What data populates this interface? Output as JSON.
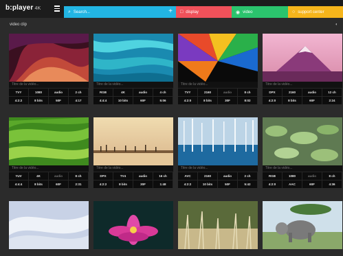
{
  "app": {
    "title": "b:player",
    "badge": "4K"
  },
  "topbar": {
    "search_placeholder": "Search...",
    "display_label": "display",
    "video_label": "video",
    "support_label": "support center"
  },
  "section": {
    "title": "video clip"
  },
  "colors": {
    "search": "#22b5e3",
    "display": "#f0515a",
    "video": "#2bc46d",
    "support": "#f6b51b"
  },
  "cards": [
    {
      "title": "Titre de la vidéo...",
      "specs": [
        "TVY",
        "1080",
        "audio",
        "2 ch",
        "4:2:2",
        "8 bits",
        "50F",
        "4:17"
      ]
    },
    {
      "title": "Titre de la vidéo...",
      "specs": [
        "RGB",
        "4K",
        "audio",
        "4 ch",
        "4:4:4",
        "10 bits",
        "60F",
        "5:06"
      ]
    },
    {
      "title": "Titre de la vidéo...",
      "specs": [
        "TVY",
        "2160",
        "audio",
        "8 ch",
        "4:2:0",
        "8 bits",
        "30F",
        "8:02"
      ]
    },
    {
      "title": "Titre de la vidéo...",
      "specs": [
        "DPX",
        "2160",
        "audio",
        "12 ch",
        "4:2:0",
        "8 bits",
        "60F",
        "2:24"
      ]
    },
    {
      "title": "Titre de la vidéo...",
      "specs": [
        "YUV",
        "4K",
        "audio",
        "8 ch",
        "4:4:4",
        "8 bits",
        "60F",
        "2:31"
      ]
    },
    {
      "title": "Titre de la vidéo...",
      "specs": [
        "DPX",
        "TV4",
        "audio",
        "16 ch",
        "4:2:2",
        "8 bits",
        "30F",
        "1:48"
      ]
    },
    {
      "title": "Titre de la vidéo...",
      "specs": [
        "AVC",
        "2160",
        "audio",
        "2 ch",
        "4:2:2",
        "10 bits",
        "50F",
        "5:42"
      ]
    },
    {
      "title": "Titre de la vidéo...",
      "specs": [
        "RGB",
        "1080",
        "audio",
        "8 ch",
        "4:2:0",
        "AAC",
        "60F",
        "4:36"
      ]
    },
    {
      "title": "",
      "specs": []
    },
    {
      "title": "",
      "specs": []
    },
    {
      "title": "",
      "specs": []
    },
    {
      "title": "",
      "specs": []
    }
  ]
}
